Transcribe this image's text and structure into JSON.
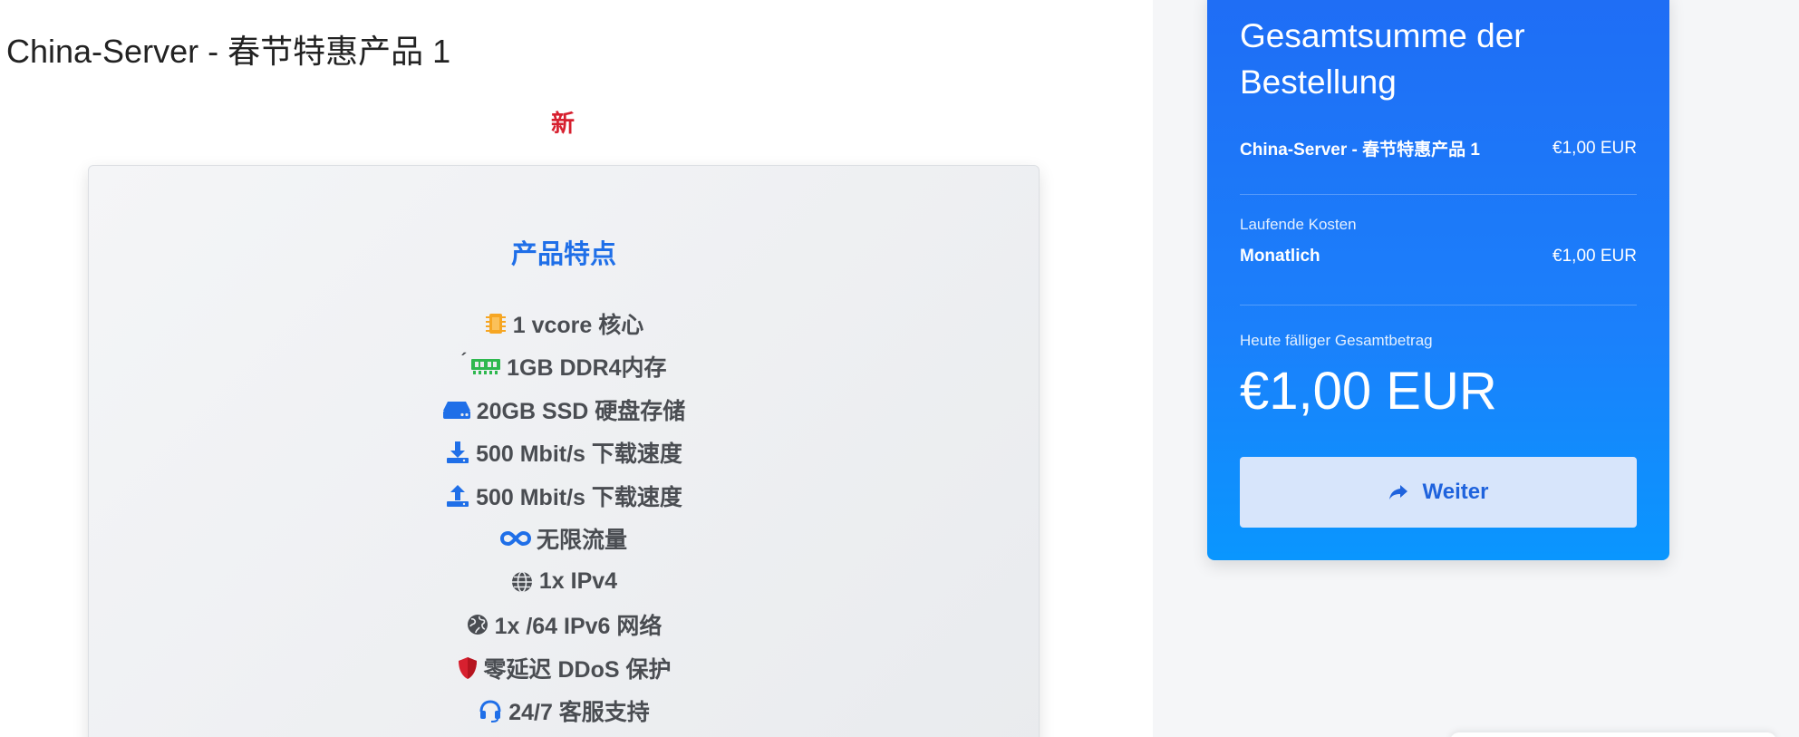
{
  "product": {
    "title": "China-Server - 春节特惠产品 1",
    "badge": "新"
  },
  "features": {
    "heading": "产品特点",
    "prefix_mark": "´",
    "items": [
      {
        "icon": "cpu-chip-icon",
        "label": "1 vcore 核心"
      },
      {
        "icon": "memory-icon",
        "label": "1GB DDR4内存"
      },
      {
        "icon": "hard-drive-icon",
        "label": "20GB SSD 硬盘存储"
      },
      {
        "icon": "download-icon",
        "label": "500 Mbit/s 下载速度"
      },
      {
        "icon": "upload-icon",
        "label": "500 Mbit/s 下载速度"
      },
      {
        "icon": "infinity-icon",
        "label": "无限流量"
      },
      {
        "icon": "globe-icon",
        "label": "1x IPv4"
      },
      {
        "icon": "globe-network-icon",
        "label": "1x /64 IPv6 网络"
      },
      {
        "icon": "shield-icon",
        "label": "零延迟 DDoS 保护"
      },
      {
        "icon": "headset-icon",
        "label": "24/7 客服支持"
      }
    ]
  },
  "summary": {
    "title": "Gesamtsumme der Bestellung",
    "line_item": {
      "label": "China-Server - 春节特惠产品 1",
      "price": "€1,00 EUR"
    },
    "recurring_label": "Laufende Kosten",
    "recurring": {
      "label": "Monatlich",
      "price": "€1,00 EUR"
    },
    "due_today_label": "Heute fälliger Gesamtbetrag",
    "total": "€1,00 EUR",
    "continue_label": "Weiter"
  },
  "colors": {
    "accent_blue": "#1f6fe8",
    "badge_red": "#d7202f",
    "summary_gradient_top": "#1f6df5",
    "summary_gradient_bottom": "#0a96fe",
    "button_bg": "#d7e5fb"
  }
}
